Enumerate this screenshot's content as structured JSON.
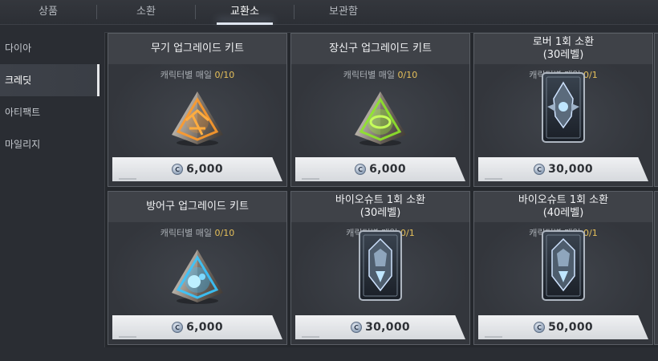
{
  "tabs": [
    {
      "label": "상품",
      "active": false
    },
    {
      "label": "소환",
      "active": false
    },
    {
      "label": "교환소",
      "active": true
    },
    {
      "label": "보관함",
      "active": false
    }
  ],
  "sidebar": {
    "items": [
      {
        "label": "다이아",
        "active": false
      },
      {
        "label": "크레딧",
        "active": true
      },
      {
        "label": "아티팩트",
        "active": false
      },
      {
        "label": "마일리지",
        "active": false
      }
    ]
  },
  "currency": {
    "icon": "credit-coin-icon",
    "symbol": "C"
  },
  "colors": {
    "limit_count": "#e6c05a",
    "accent": "#dfe6f0"
  },
  "cards": [
    {
      "title_line1": "무기 업그레이드 키트",
      "title_line2": "",
      "limit_label": "캐릭터별 매일",
      "limit_count": "0/10",
      "price": "6,000",
      "icon": "weapon-kit-icon"
    },
    {
      "title_line1": "장신구 업그레이드 키트",
      "title_line2": "",
      "limit_label": "캐릭터별 매일",
      "limit_count": "0/10",
      "price": "6,000",
      "icon": "accessory-kit-icon"
    },
    {
      "title_line1": "로버 1회 소환",
      "title_line2": "(30레벨)",
      "limit_label": "캐릭터별 매일",
      "limit_count": "0/1",
      "price": "30,000",
      "icon": "rover-card-icon"
    },
    {
      "title_line1": "방어구 업그레이드 키트",
      "title_line2": "",
      "limit_label": "캐릭터별 매일",
      "limit_count": "0/10",
      "price": "6,000",
      "icon": "armor-kit-icon"
    },
    {
      "title_line1": "바이오슈트 1회 소환",
      "title_line2": "(30레벨)",
      "limit_label": "캐릭터별 매일",
      "limit_count": "0/1",
      "price": "30,000",
      "icon": "biosuit-card-icon"
    },
    {
      "title_line1": "바이오슈트 1회 소환",
      "title_line2": "(40레벨)",
      "limit_label": "캐릭터별 매일",
      "limit_count": "0/1",
      "price": "50,000",
      "icon": "biosuit-card-icon"
    }
  ]
}
